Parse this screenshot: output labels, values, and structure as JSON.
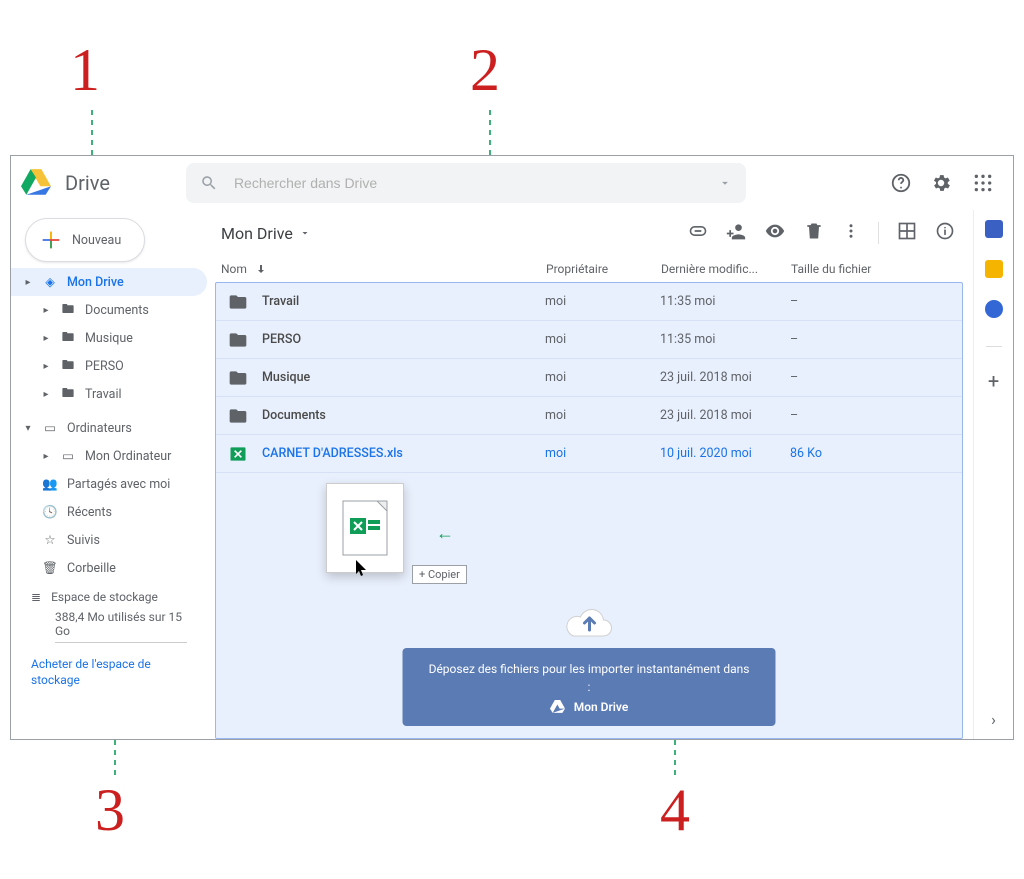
{
  "annotations": {
    "num1": "1",
    "num2": "2",
    "num3": "3",
    "num4": "4"
  },
  "header": {
    "app_name": "Drive",
    "search_placeholder": "Rechercher dans Drive"
  },
  "sidebar": {
    "new_button": "Nouveau",
    "my_drive": "Mon Drive",
    "folders": [
      "Documents",
      "Musique",
      "PERSO",
      "Travail"
    ],
    "computers": "Ordinateurs",
    "my_computer": "Mon Ordinateur",
    "shared": "Partagés avec moi",
    "recent": "Récents",
    "followed": "Suivis",
    "trash": "Corbeille",
    "storage_label": "Espace de stockage",
    "storage_usage": "388,4 Mo utilisés sur 15 Go",
    "buy_link": "Acheter de l'espace de stockage"
  },
  "toolbar": {
    "breadcrumb": "Mon Drive"
  },
  "columns": {
    "name": "Nom",
    "owner": "Propriétaire",
    "modified": "Dernière modific...",
    "size": "Taille du fichier"
  },
  "rows": [
    {
      "name": "Travail",
      "owner": "moi",
      "modified": "11:35 moi",
      "size": "–",
      "kind": "folder"
    },
    {
      "name": "PERSO",
      "owner": "moi",
      "modified": "11:35 moi",
      "size": "–",
      "kind": "folder"
    },
    {
      "name": "Musique",
      "owner": "moi",
      "modified": "23 juil. 2018 moi",
      "size": "–",
      "kind": "folder"
    },
    {
      "name": "Documents",
      "owner": "moi",
      "modified": "23 juil. 2018 moi",
      "size": "–",
      "kind": "folder"
    },
    {
      "name": "CARNET D'ADRESSES.xls",
      "owner": "moi",
      "modified": "10 juil. 2020 moi",
      "size": "86 Ko",
      "kind": "excel"
    }
  ],
  "ghost_tooltip": "+ Copier",
  "drop_banner": {
    "line1": "Déposez des fichiers pour les importer instantanément dans :",
    "line2": "Mon Drive"
  }
}
